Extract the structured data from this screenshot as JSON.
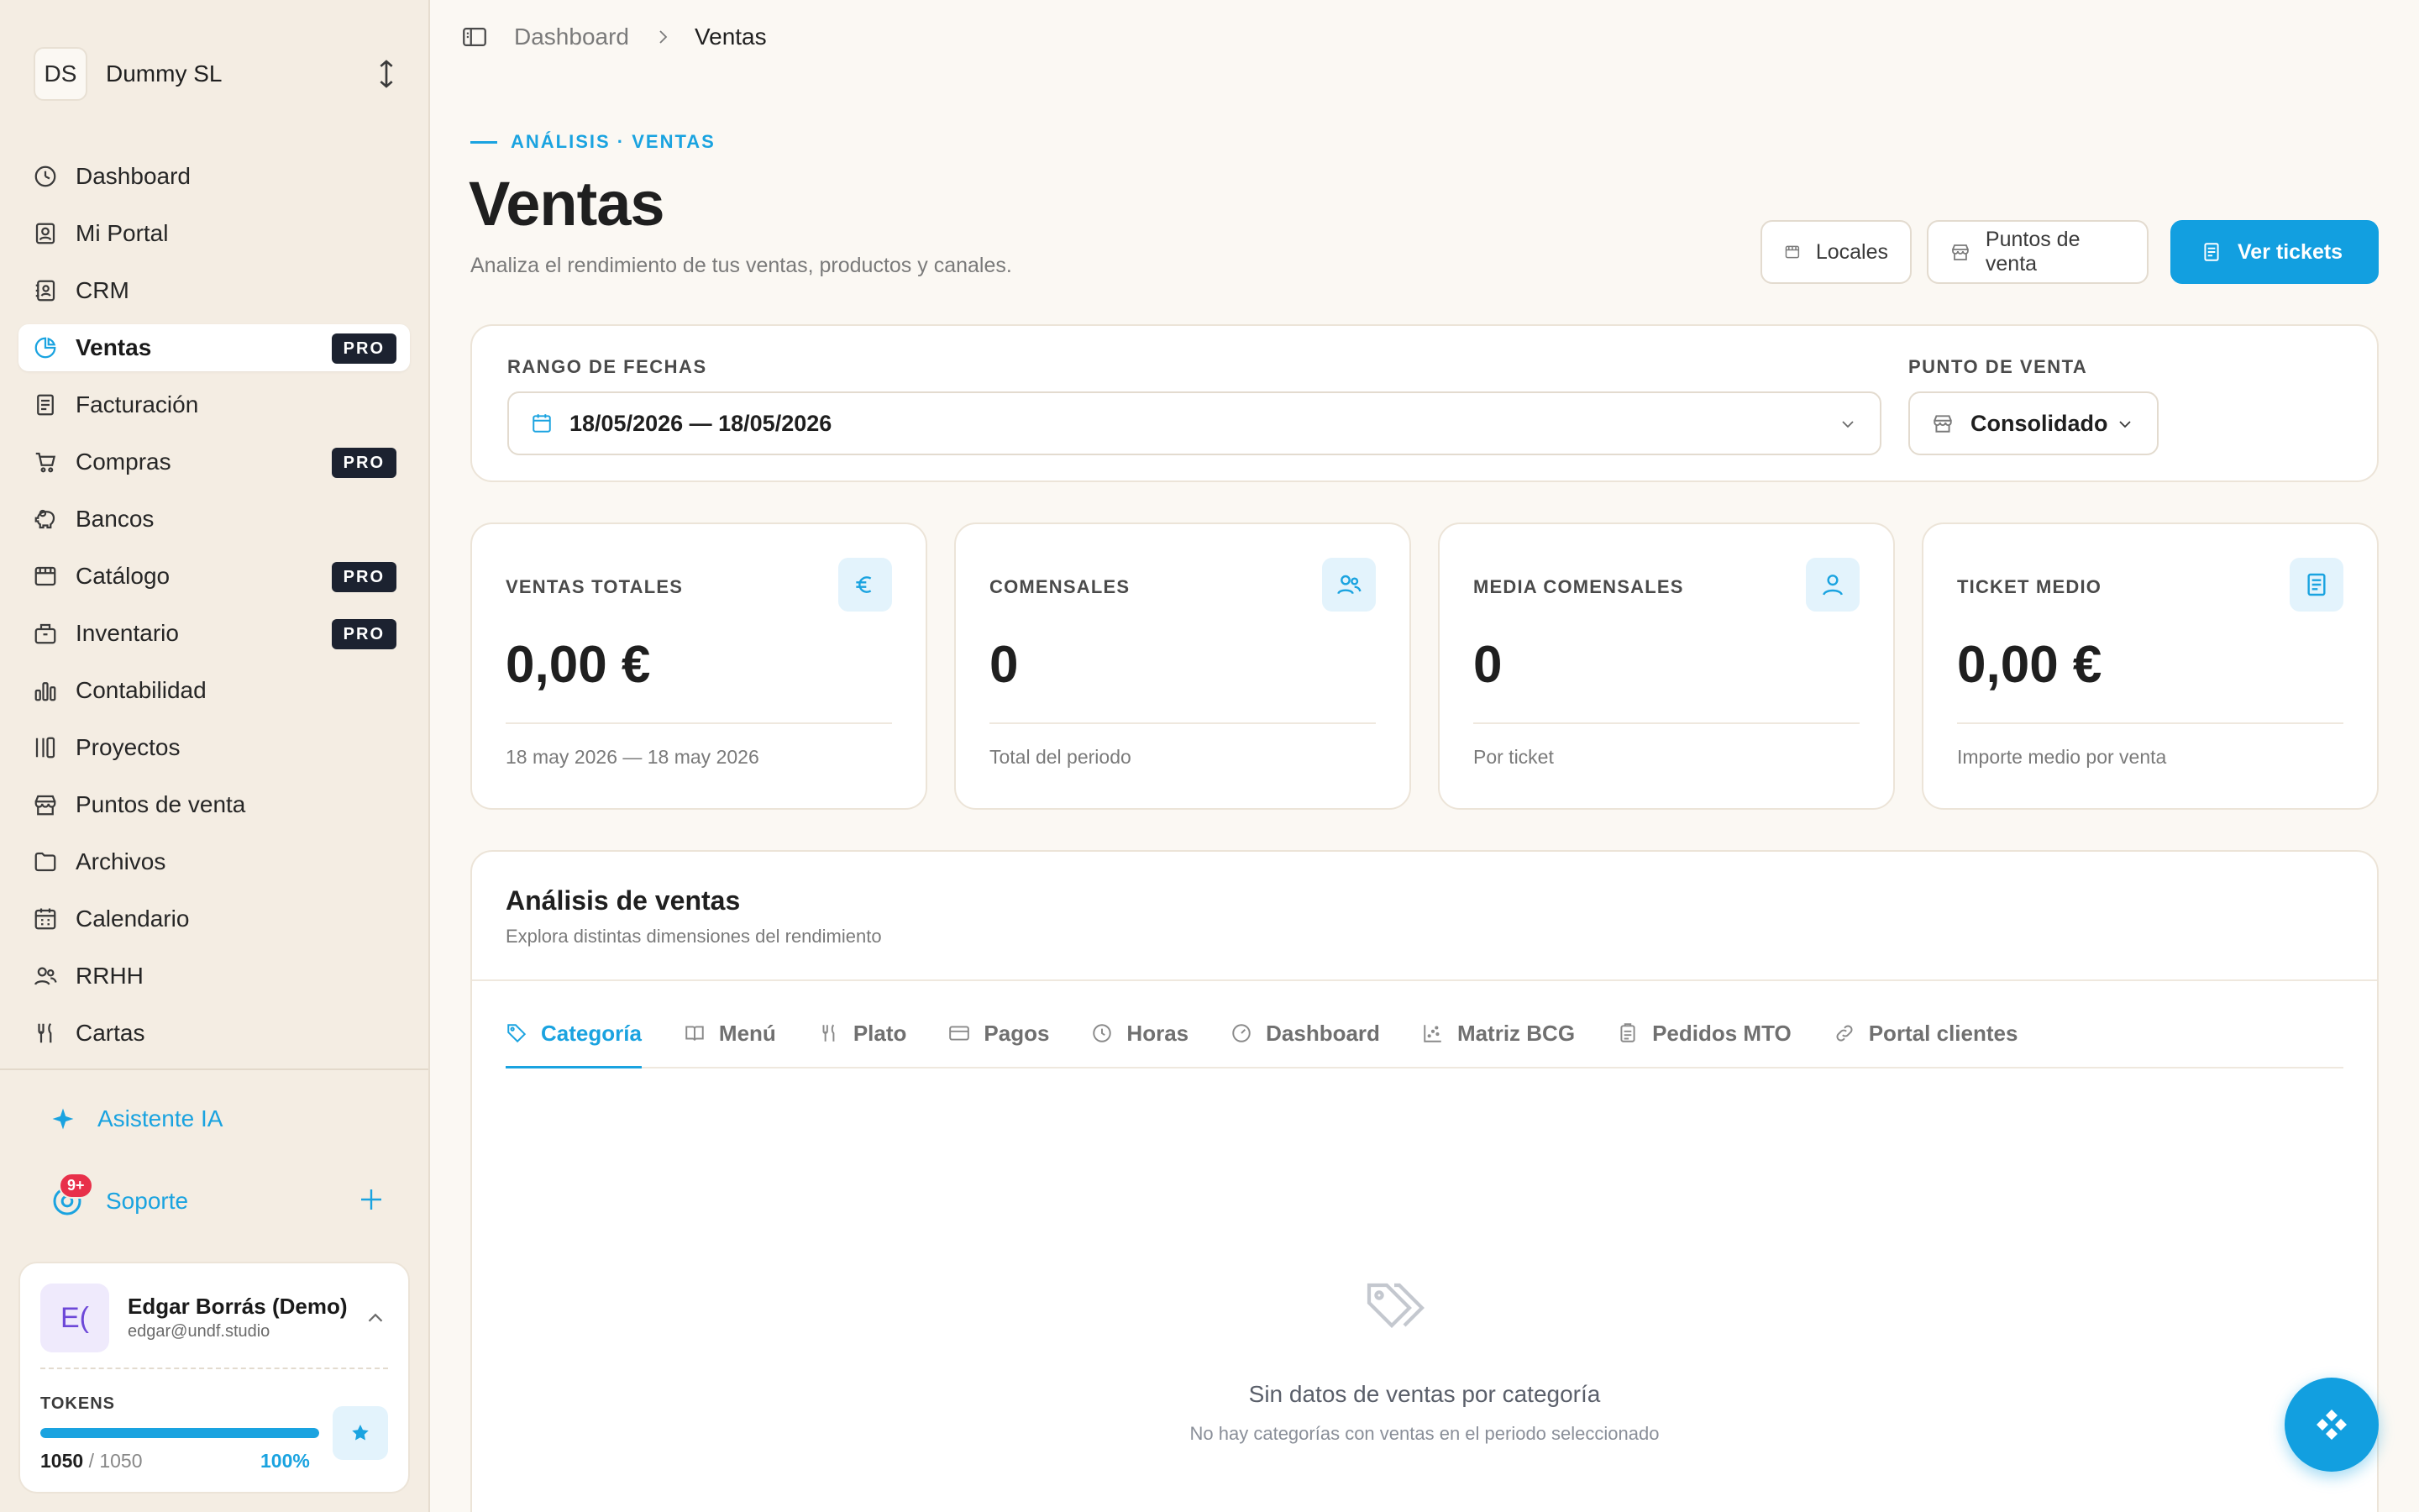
{
  "org": {
    "initials": "DS",
    "name": "Dummy SL"
  },
  "nav": [
    {
      "label": "Dashboard",
      "icon": "dashboard-icon",
      "pro": ""
    },
    {
      "label": "Mi Portal",
      "icon": "portal-icon",
      "pro": ""
    },
    {
      "label": "CRM",
      "icon": "contacts-icon",
      "pro": ""
    },
    {
      "label": "Ventas",
      "icon": "pie-chart-icon",
      "pro": "PRO",
      "active": true
    },
    {
      "label": "Facturación",
      "icon": "invoice-icon",
      "pro": ""
    },
    {
      "label": "Compras",
      "icon": "cart-icon",
      "pro": "PRO"
    },
    {
      "label": "Bancos",
      "icon": "piggy-bank-icon",
      "pro": ""
    },
    {
      "label": "Catálogo",
      "icon": "catalog-icon",
      "pro": "PRO"
    },
    {
      "label": "Inventario",
      "icon": "inventory-icon",
      "pro": "PRO"
    },
    {
      "label": "Contabilidad",
      "icon": "bar-chart-icon",
      "pro": ""
    },
    {
      "label": "Proyectos",
      "icon": "kanban-icon",
      "pro": ""
    },
    {
      "label": "Puntos de venta",
      "icon": "store-icon",
      "pro": ""
    },
    {
      "label": "Archivos",
      "icon": "folder-icon",
      "pro": ""
    },
    {
      "label": "Calendario",
      "icon": "calendar-icon",
      "pro": ""
    },
    {
      "label": "RRHH",
      "icon": "people-icon",
      "pro": ""
    },
    {
      "label": "Cartas",
      "icon": "utensils-icon",
      "pro": ""
    }
  ],
  "assistant": {
    "label": "Asistente IA"
  },
  "support": {
    "label": "Soporte",
    "badge": "9+"
  },
  "user": {
    "initials": "E(",
    "name": "Edgar Borrás (Demo)",
    "email": "edgar@undf.studio",
    "tokens_label": "TOKENS",
    "tokens_used": "1050",
    "tokens_total": "/ 1050",
    "tokens_pct": "100%",
    "tokens_fraction": 1.0
  },
  "breadcrumb": {
    "root": "Dashboard",
    "current": "Ventas"
  },
  "header": {
    "eyebrow": "ANÁLISIS · VENTAS",
    "title": "Ventas",
    "subtitle": "Analiza el rendimiento de tus ventas, productos y canales.",
    "btn_locales": "Locales",
    "btn_puntos": "Puntos de venta",
    "btn_tickets": "Ver tickets"
  },
  "filters": {
    "date_label": "RANGO DE FECHAS",
    "date_value": "18/05/2026 — 18/05/2026",
    "pos_label": "PUNTO DE VENTA",
    "pos_value": "Consolidado"
  },
  "stats": [
    {
      "label": "VENTAS TOTALES",
      "value": "0,00 €",
      "foot": "18 may 2026 — 18 may 2026",
      "icon": "euro-icon"
    },
    {
      "label": "COMENSALES",
      "value": "0",
      "foot": "Total del periodo",
      "icon": "people-icon"
    },
    {
      "label": "MEDIA COMENSALES",
      "value": "0",
      "foot": "Por ticket",
      "icon": "user-icon"
    },
    {
      "label": "TICKET MEDIO",
      "value": "0,00 €",
      "foot": "Importe medio por venta",
      "icon": "receipt-icon"
    }
  ],
  "analysis": {
    "title": "Análisis de ventas",
    "subtitle": "Explora distintas dimensiones del rendimiento",
    "tabs": [
      "Categoría",
      "Menú",
      "Plato",
      "Pagos",
      "Horas",
      "Dashboard",
      "Matriz BCG",
      "Pedidos MTO",
      "Portal clientes"
    ],
    "active_tab": "Categoría",
    "empty_title": "Sin datos de ventas por categoría",
    "empty_sub": "No hay categorías con ventas en el periodo seleccionado"
  },
  "colors": {
    "accent": "#1aa3e0",
    "pro_badge": "#1c2230",
    "sidebar_bg": "#f4ede3",
    "page_bg": "#fbf8f3"
  }
}
